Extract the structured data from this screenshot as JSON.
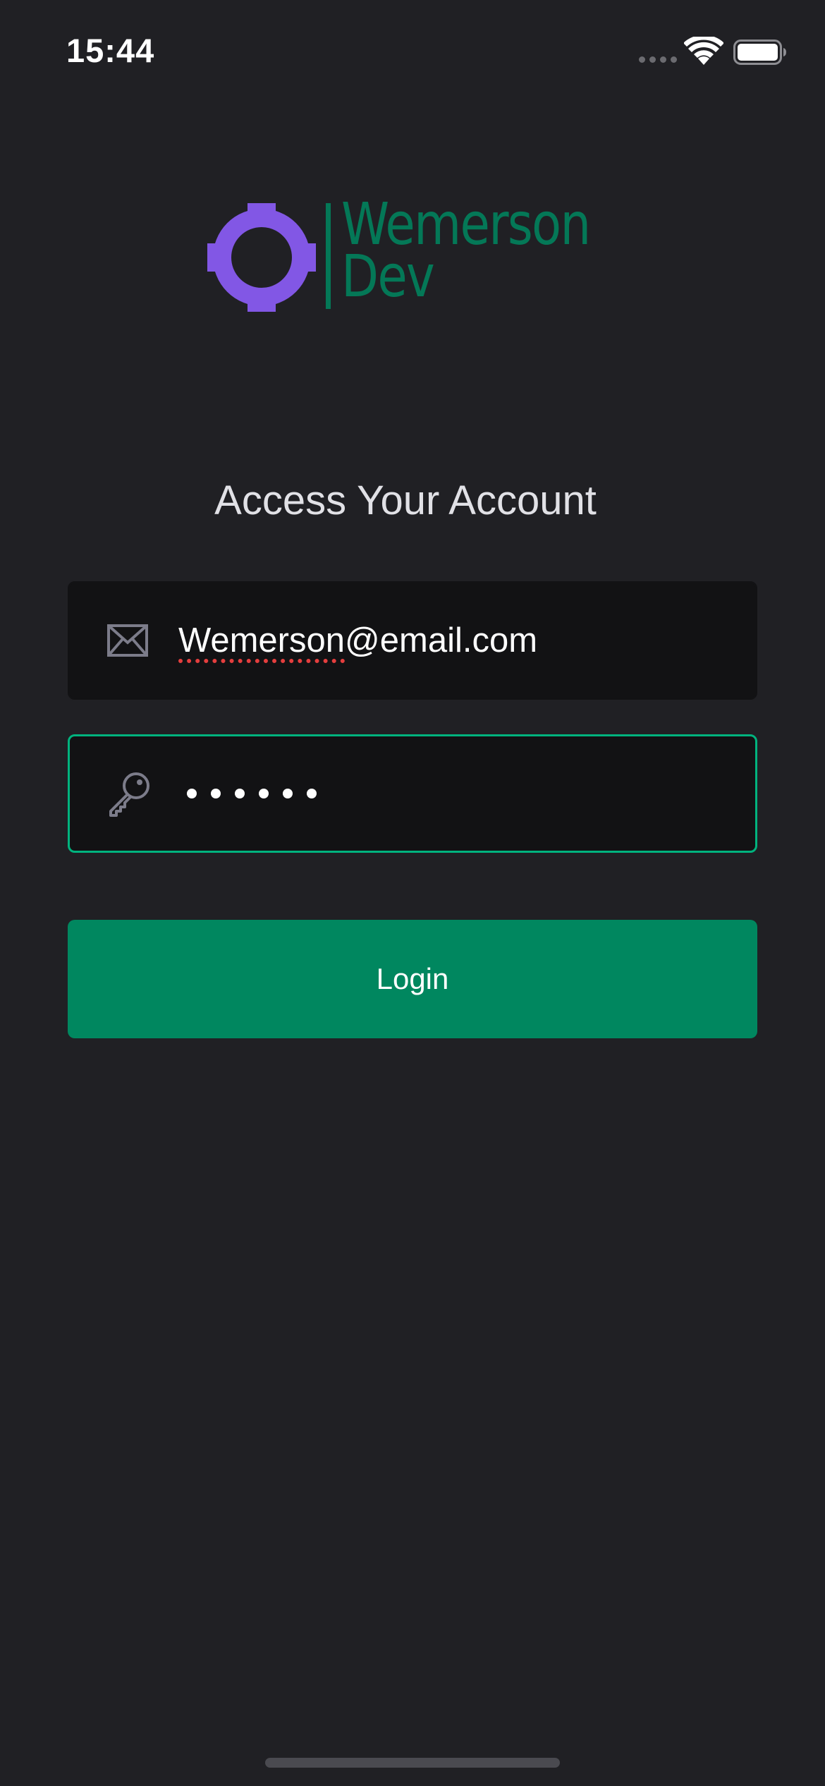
{
  "status_bar": {
    "time": "15:44",
    "icons": [
      "signal-dots-icon",
      "wifi-icon",
      "battery-icon"
    ]
  },
  "logo": {
    "line1": "Wemerson",
    "line2": "Dev",
    "mark_color": "#8257e5",
    "text_color": "#047857"
  },
  "heading": "Access Your Account",
  "email_field": {
    "icon": "envelope-icon",
    "value_underlined": "Wemerson",
    "value_rest": "@email.com"
  },
  "password_field": {
    "icon": "key-icon",
    "masked_length": 6,
    "focused": true
  },
  "login_button": {
    "label": "Login",
    "color": "#00875f"
  },
  "colors": {
    "background": "#202024",
    "input_background": "#121214",
    "focus_border": "#00b37e"
  }
}
